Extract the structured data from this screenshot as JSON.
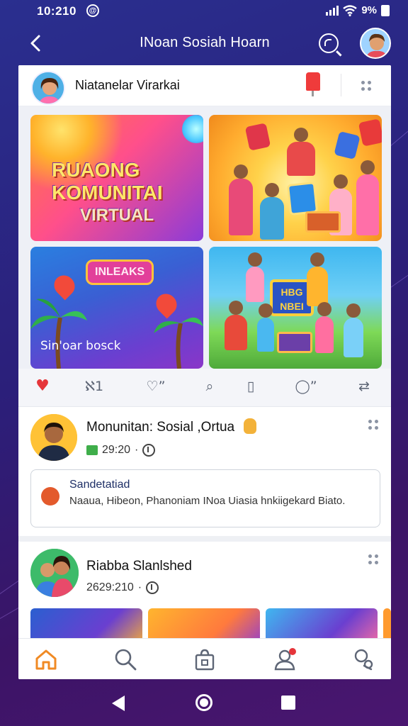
{
  "status_bar": {
    "time": "10:210",
    "notification_glyph": "@",
    "battery_text": "9%"
  },
  "header": {
    "back_glyph": "‹",
    "title": "INoan Sosiah Hoarn"
  },
  "post": {
    "author_name": "Niatanelar Virarkai",
    "images": {
      "tile1_lines": [
        "RUAONG",
        "KOMUNITAI",
        "VIRTUAL"
      ],
      "tile3_badge": "INLEAKS",
      "tile3_caption": "Sin'oar bosck",
      "tile4_sign": "HBG NBEI"
    },
    "actions": {
      "like_glyph": "♥",
      "comment_label": "ℵ1",
      "react_label": "♡”",
      "search_glyph": "⌕",
      "save_glyph": "▯",
      "share_label": "◯”",
      "more_glyph": "⇄"
    }
  },
  "feed": [
    {
      "name": "Monunitan: Sosial ,Ortua",
      "meta": "29:20",
      "shared": {
        "title": "Sandetatiad",
        "text": "Naaua, Hibeon, Phanoniam INoa Uiasia hnkiigekard Biato."
      }
    },
    {
      "name": "Riabba Slanlshed",
      "meta": "2629:210"
    }
  ],
  "colors": {
    "accent": "#2a2f8f",
    "like_red": "#e5353a",
    "nav_active": "#f08a24"
  },
  "icons": {
    "header": [
      "back-arrow-icon",
      "search-icon",
      "profile-avatar-icon"
    ],
    "bottom_nav": [
      "home-icon",
      "search-icon",
      "shop-bag-icon",
      "profile-icon",
      "people-icon"
    ]
  }
}
